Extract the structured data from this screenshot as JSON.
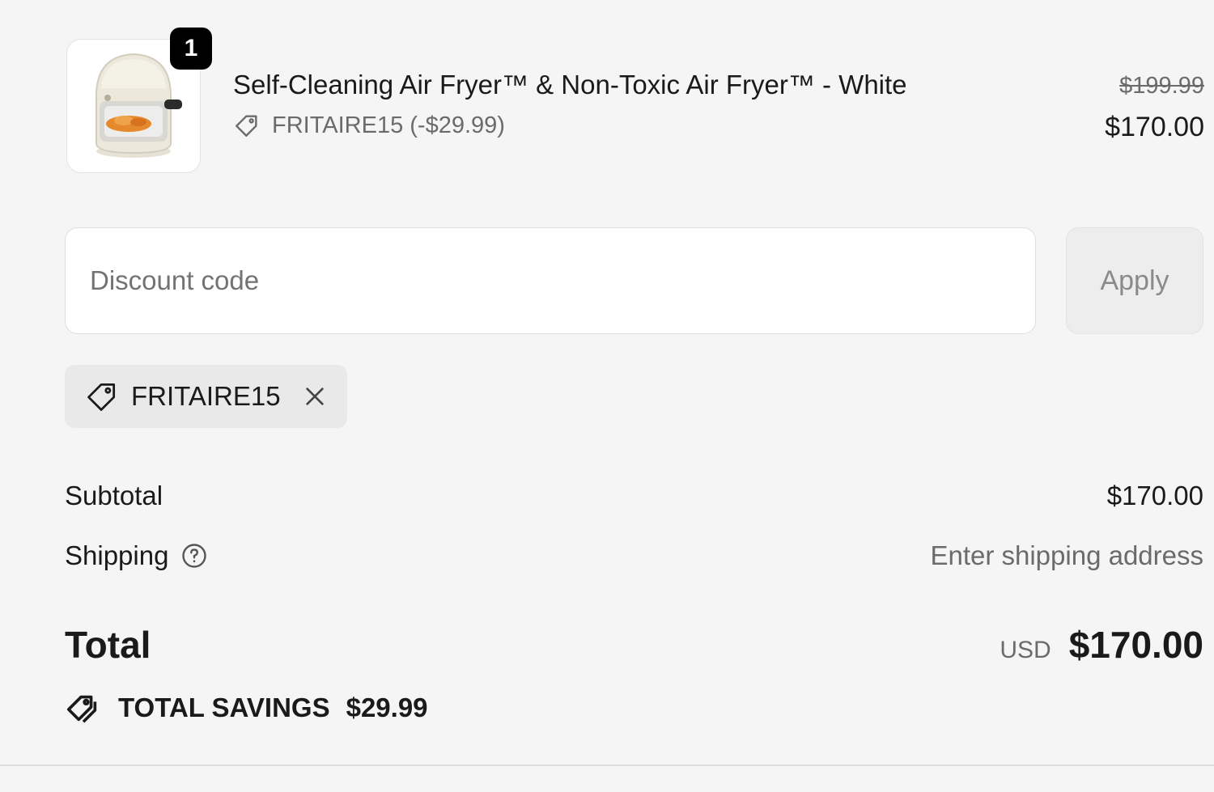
{
  "line_item": {
    "quantity": "1",
    "title": "Self-Cleaning Air Fryer™ & Non-Toxic Air Fryer™ - White",
    "discount_line": "FRITAIRE15 (-$29.99)",
    "original_price": "$199.99",
    "price": "$170.00",
    "image_icon": "air-fryer-product-image"
  },
  "discount": {
    "placeholder": "Discount code",
    "apply_label": "Apply"
  },
  "applied_code": {
    "code": "FRITAIRE15",
    "tag_icon": "tag-icon",
    "remove_icon": "close-icon"
  },
  "totals": {
    "subtotal_label": "Subtotal",
    "subtotal_value": "$170.00",
    "shipping_label": "Shipping",
    "shipping_value": "Enter shipping address",
    "total_label": "Total",
    "currency": "USD",
    "total_value": "$170.00",
    "savings_label": "TOTAL SAVINGS",
    "savings_value": "$29.99"
  },
  "colors": {
    "background": "#f5f5f5",
    "text": "#1a1a1a",
    "muted_text": "#6b6b6b",
    "badge": "#000000",
    "chip": "#e9e9e9"
  }
}
